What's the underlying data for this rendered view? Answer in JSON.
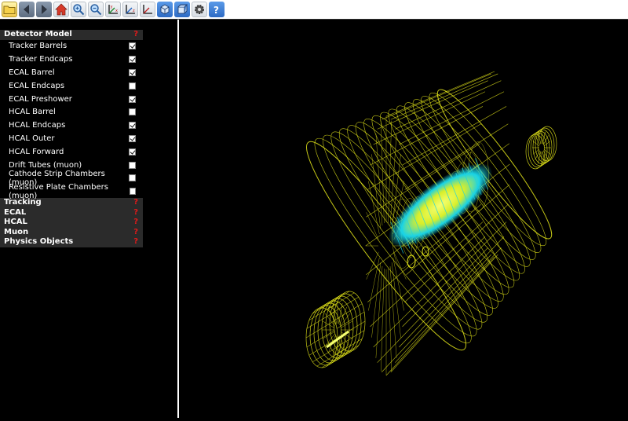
{
  "toolbar": {
    "buttons": [
      {
        "name": "open-file-button",
        "icon": "folder-icon"
      },
      {
        "name": "previous-event-button",
        "icon": "left-arrow-icon"
      },
      {
        "name": "next-event-button",
        "icon": "right-arrow-icon"
      },
      {
        "name": "home-view-button",
        "icon": "home-icon"
      },
      {
        "name": "zoom-in-button",
        "icon": "zoom-in-icon"
      },
      {
        "name": "zoom-out-button",
        "icon": "zoom-out-icon"
      },
      {
        "name": "view-xy-button",
        "icon": "axes-xy-icon"
      },
      {
        "name": "view-yz-button",
        "icon": "axes-yz-icon"
      },
      {
        "name": "view-xz-button",
        "icon": "axes-xz-icon"
      },
      {
        "name": "perspective-button",
        "icon": "cube-perspective-icon"
      },
      {
        "name": "orthographic-button",
        "icon": "cube-ortho-icon"
      },
      {
        "name": "settings-button",
        "icon": "gear-icon"
      },
      {
        "name": "help-button",
        "icon": "question-icon"
      }
    ],
    "axis_labels": {
      "x": "x",
      "y": "y",
      "z": "z"
    },
    "help_glyph": "?"
  },
  "panel": {
    "detector_model": {
      "title": "Detector Model",
      "help": "?",
      "items": [
        {
          "label": "Tracker Barrels",
          "checked": true
        },
        {
          "label": "Tracker Endcaps",
          "checked": true
        },
        {
          "label": "ECAL Barrel",
          "checked": true
        },
        {
          "label": "ECAL Endcaps",
          "checked": false
        },
        {
          "label": "ECAL Preshower",
          "checked": true
        },
        {
          "label": "HCAL Barrel",
          "checked": false
        },
        {
          "label": "HCAL Endcaps",
          "checked": true
        },
        {
          "label": "HCAL Outer",
          "checked": true
        },
        {
          "label": "HCAL Forward",
          "checked": true
        },
        {
          "label": "Drift Tubes (muon)",
          "checked": false
        },
        {
          "label": "Cathode Strip Chambers (muon)",
          "checked": false
        },
        {
          "label": "Resistive Plate Chambers (muon)",
          "checked": false
        }
      ]
    },
    "sections": [
      {
        "title": "Tracking",
        "help": "?"
      },
      {
        "title": "ECAL",
        "help": "?"
      },
      {
        "title": "HCAL",
        "help": "?"
      },
      {
        "title": "Muon",
        "help": "?"
      },
      {
        "title": "Physics Objects",
        "help": "?"
      }
    ]
  },
  "viewer": {
    "wireframe_color": "#e8ea1a",
    "core_color": "#19d3e6",
    "background": "#000000"
  }
}
